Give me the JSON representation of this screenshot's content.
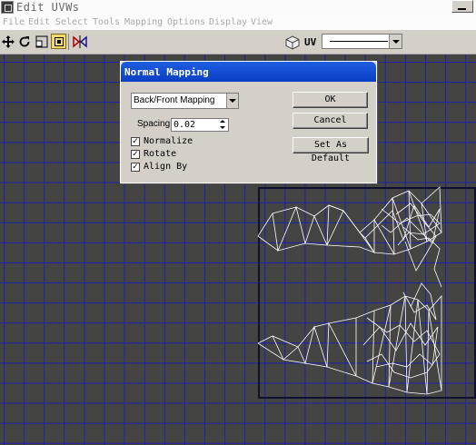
{
  "window": {
    "title": "Edit UVWs",
    "icon": "uvw-window-icon"
  },
  "menu": [
    "File",
    "Edit",
    "Select",
    "Tools",
    "Mapping",
    "Options",
    "Display",
    "View"
  ],
  "toolbar": {
    "tools": [
      "move-icon",
      "rotate-icon",
      "scale-icon",
      "freeform-icon",
      "mirror-icon"
    ],
    "active_tool": "freeform-icon",
    "map_channel_label": "UV",
    "texture_value": "————————"
  },
  "dialog": {
    "title": "Normal Mapping",
    "mapping_type": "Back/Front Mapping",
    "spacing_label": "Spacing:",
    "spacing_value": "0.02",
    "checkboxes": [
      {
        "label": "Normalize",
        "checked": true
      },
      {
        "label": "Rotate",
        "checked": true
      },
      {
        "label": "Align By",
        "checked": true
      }
    ],
    "ok_label": "OK",
    "cancel_label": "Cancel",
    "default_label": "Set As Default"
  },
  "colors": {
    "viewport_bg": "#444443",
    "grid_line": "#1f1fae",
    "mesh_line": "#ffffff",
    "dialog_title": "#0a3fc4",
    "active_tool": "#f3d86a"
  }
}
